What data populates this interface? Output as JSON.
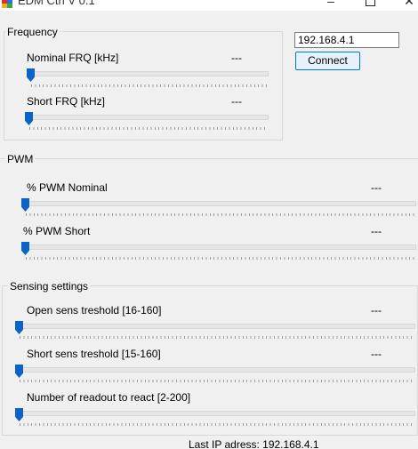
{
  "window": {
    "title": "EDM Ctrl V 0.1",
    "controls": {
      "minimize": "–",
      "maximize": "",
      "close": "✕"
    }
  },
  "connection": {
    "ip_value": "192.168.4.1",
    "connect_label": "Connect"
  },
  "frequency": {
    "title": "Frequency",
    "sliders": [
      {
        "label": "Nominal FRQ [kHz]",
        "value_text": "---",
        "level": 0
      },
      {
        "label": "Short FRQ [kHz]",
        "value_text": "---",
        "level": 0
      }
    ]
  },
  "pwm": {
    "title": "PWM",
    "sliders": [
      {
        "label": "% PWM Nominal",
        "value_text": "---",
        "level": 0
      },
      {
        "label": "% PWM Short",
        "value_text": "---",
        "level": 0
      }
    ]
  },
  "sensing": {
    "title": "Sensing settings",
    "sliders": [
      {
        "label": "Open sens treshold [16-160]",
        "value_text": "---",
        "level": 0
      },
      {
        "label": "Short sens treshold [15-160]",
        "value_text": "---",
        "level": 0
      },
      {
        "label": "Number of readout to react [2-200]",
        "value_text": "",
        "level": 0
      }
    ]
  },
  "status": {
    "last_ip_label": "Last IP adress: 192.168.4.1"
  },
  "colors": {
    "thumb": "#0a64c8",
    "button_border": "#0078d7",
    "background": "#f0f0f0"
  }
}
